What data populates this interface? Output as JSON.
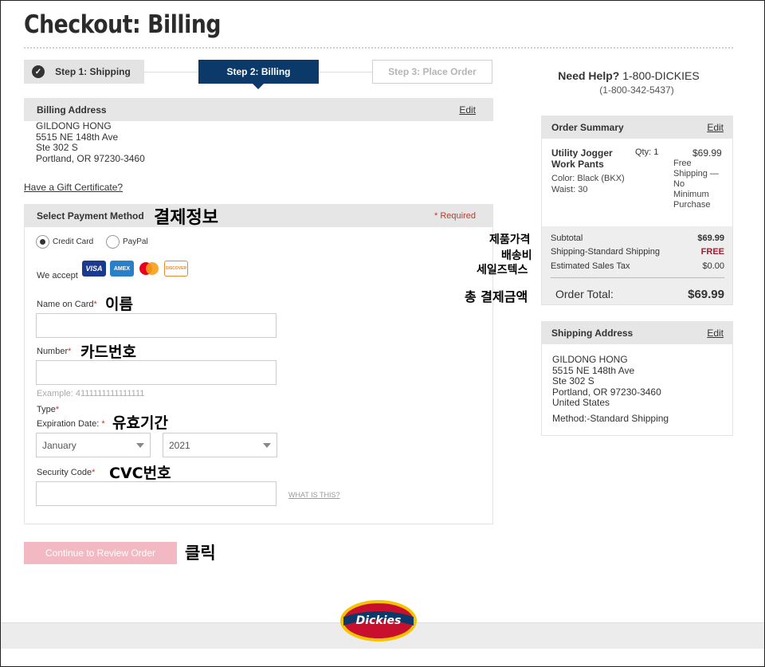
{
  "page": {
    "title": "Checkout: Billing"
  },
  "steps": [
    {
      "label": "Step 1: Shipping"
    },
    {
      "label": "Step 2: Billing"
    },
    {
      "label": "Step 3: Place Order"
    }
  ],
  "billing": {
    "header": "Billing Address",
    "edit_label": "Edit",
    "address": [
      "GILDONG HONG",
      "5515 NE 148th Ave",
      "Ste 302 S",
      "Portland, OR 97230-3460"
    ]
  },
  "gift_link": "Have a Gift Certificate?",
  "payment": {
    "header": "Select Payment Method",
    "required_note": "* Required",
    "options": [
      {
        "label": "Credit Card",
        "selected": true
      },
      {
        "label": "PayPal",
        "selected": false
      }
    ],
    "we_accept": "We accept",
    "cards": [
      "VISA",
      "AMEX",
      "MC",
      "DISCOVER"
    ],
    "name_label": "Name on Card",
    "name_value": "",
    "number_label": "Number",
    "number_value": "",
    "number_example": "Example: 4111111111111111",
    "type_label": "Type",
    "exp_label": "Expiration Date:",
    "exp_month": "January",
    "exp_year": "2021",
    "security_label": "Security Code",
    "security_value": "",
    "what_is_this": "WHAT IS THIS?",
    "required_mark": "*"
  },
  "continue_button": "Continue to Review Order",
  "annotations": {
    "payment_info": "결제정보",
    "name": "이름",
    "card_number": "카드번호",
    "expiry": "유효기간",
    "cvc": "CVC번호",
    "click": "클릭",
    "product_price": "제품가격",
    "shipping": "배송비",
    "sales_tax": "세일즈텍스",
    "total": "총 결제금액"
  },
  "help": {
    "label": "Need Help?",
    "phone": "1-800-DICKIES",
    "phone_numeric": "(1-800-342-5437)"
  },
  "order_summary": {
    "header": "Order Summary",
    "edit_label": "Edit",
    "item": {
      "name_line1": "Utility Jogger",
      "name_line2": "Work Pants",
      "qty": "Qty: 1",
      "price": "$69.99",
      "color": "Color: Black (BKX)",
      "waist": "Waist: 30",
      "shipping_note": [
        "Free",
        "Shipping —",
        "No",
        "Minimum",
        "Purchase"
      ]
    },
    "subtotal_label": "Subtotal",
    "subtotal_value": "$69.99",
    "shipping_label": "Shipping-Standard Shipping",
    "shipping_value": "FREE",
    "tax_label": "Estimated Sales Tax",
    "tax_value": "$0.00",
    "total_label": "Order Total:",
    "total_value": "$69.99"
  },
  "shipping_address": {
    "header": "Shipping Address",
    "edit_label": "Edit",
    "lines": [
      "GILDONG HONG",
      "5515 NE 148th Ave",
      "Ste 302 S",
      "Portland, OR 97230-3460",
      "United States"
    ],
    "method": "Method:-Standard Shipping"
  },
  "logo": {
    "text": "Dickies"
  },
  "colors": {
    "primary": "#0b3a6a",
    "button_disabled": "#f2b9c2",
    "required": "#c0392b",
    "free": "#a31b2f"
  }
}
